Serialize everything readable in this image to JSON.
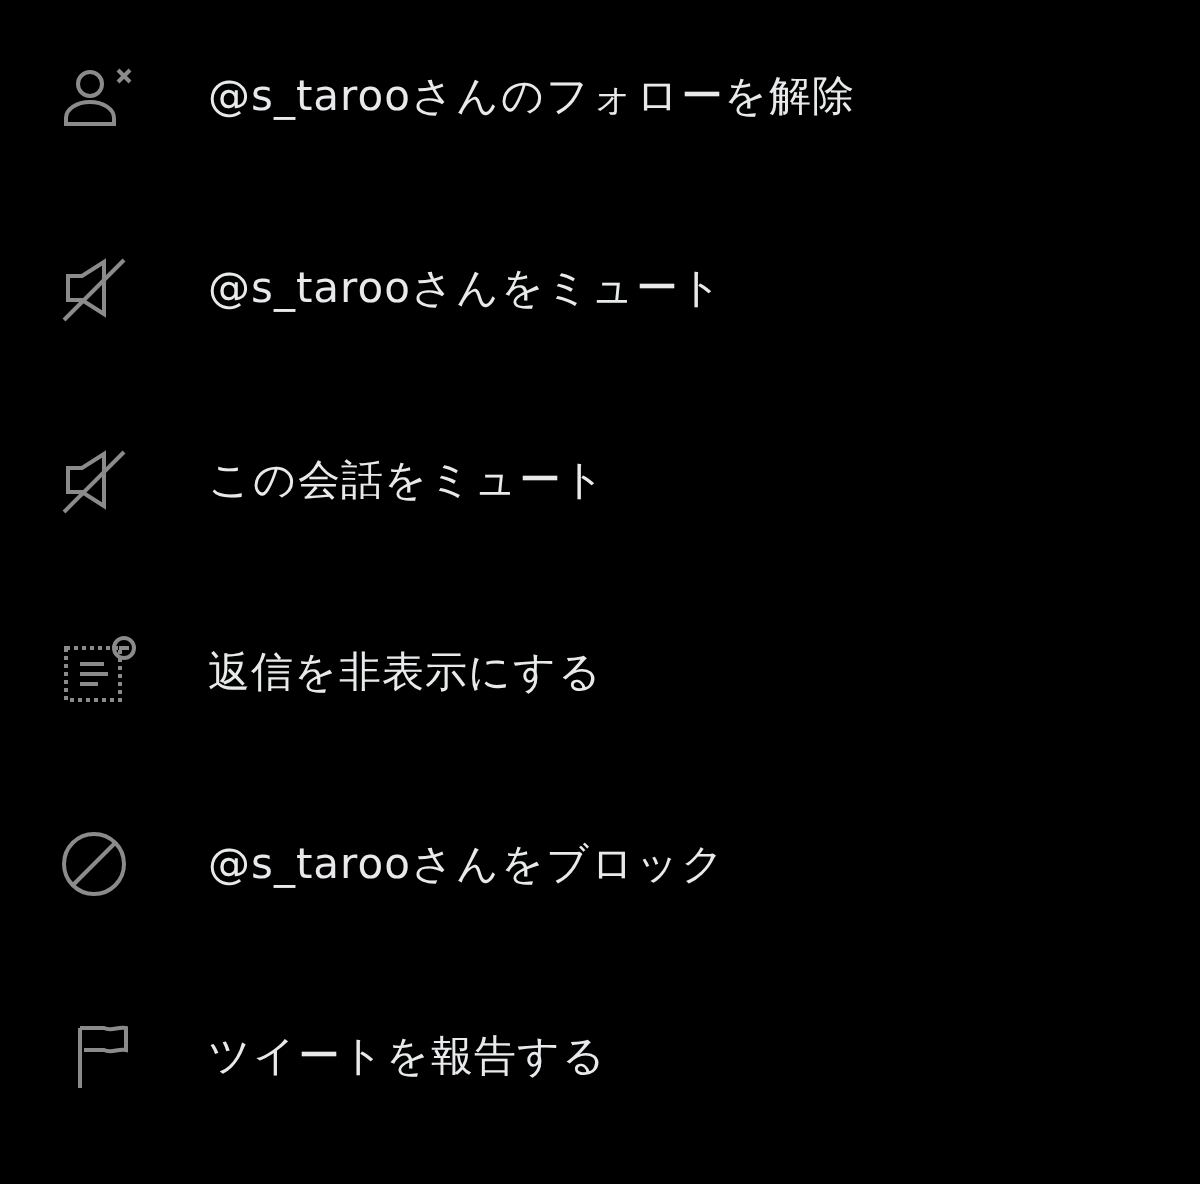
{
  "menu": {
    "items": [
      {
        "kind": "unfollow",
        "label": "@s_tarooさんのフォローを解除"
      },
      {
        "kind": "mute",
        "label": "@s_tarooさんをミュート"
      },
      {
        "kind": "mute",
        "label": "この会話をミュート"
      },
      {
        "kind": "hide",
        "label": "返信を非表示にする"
      },
      {
        "kind": "block",
        "label": "@s_tarooさんをブロック"
      },
      {
        "kind": "report",
        "label": "ツイートを報告する"
      }
    ]
  }
}
